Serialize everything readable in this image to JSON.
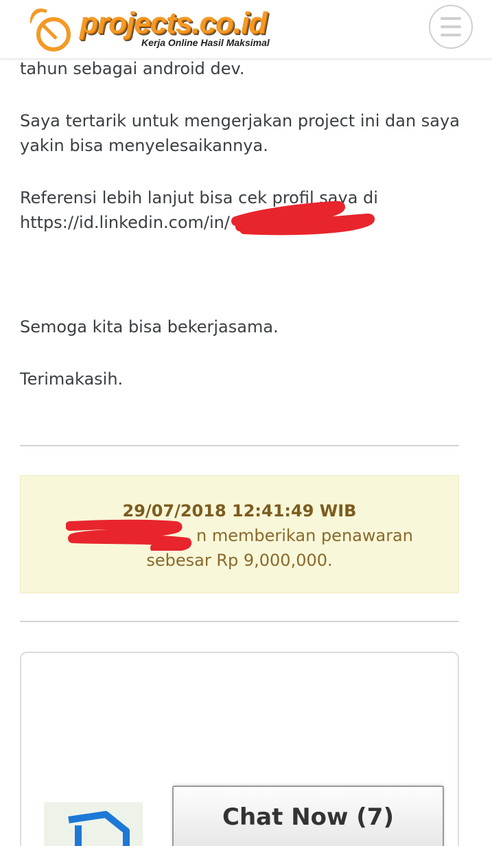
{
  "header": {
    "logo_text": "projects.co.id",
    "logo_tagline": "Kerja Online Hasil Maksimal",
    "menu_icon": "hamburger-menu-icon"
  },
  "message": {
    "lines": [
      "tahun sebagai android dev.",
      "Saya tertarik untuk mengerjakan project ini dan saya",
      "yakin bisa menyelesaikannya.",
      "Referensi lebih lanjut bisa cek profil saya di",
      "https://id.linkedin.com/in/",
      "Semoga kita bisa bekerjasama.",
      "Terimakasih."
    ]
  },
  "offer": {
    "datetime": "29/07/2018 12:41:49 WIB",
    "text_suffix": "n memberikan penawaran",
    "text_line2": "sebesar Rp 9,000,000."
  },
  "chat": {
    "label": "Chat Now (7)"
  },
  "colors": {
    "brand_orange": "#f39a26",
    "offer_bg": "#f8f7d9",
    "offer_text": "#8a6a2c",
    "redaction": "#e8252d"
  }
}
